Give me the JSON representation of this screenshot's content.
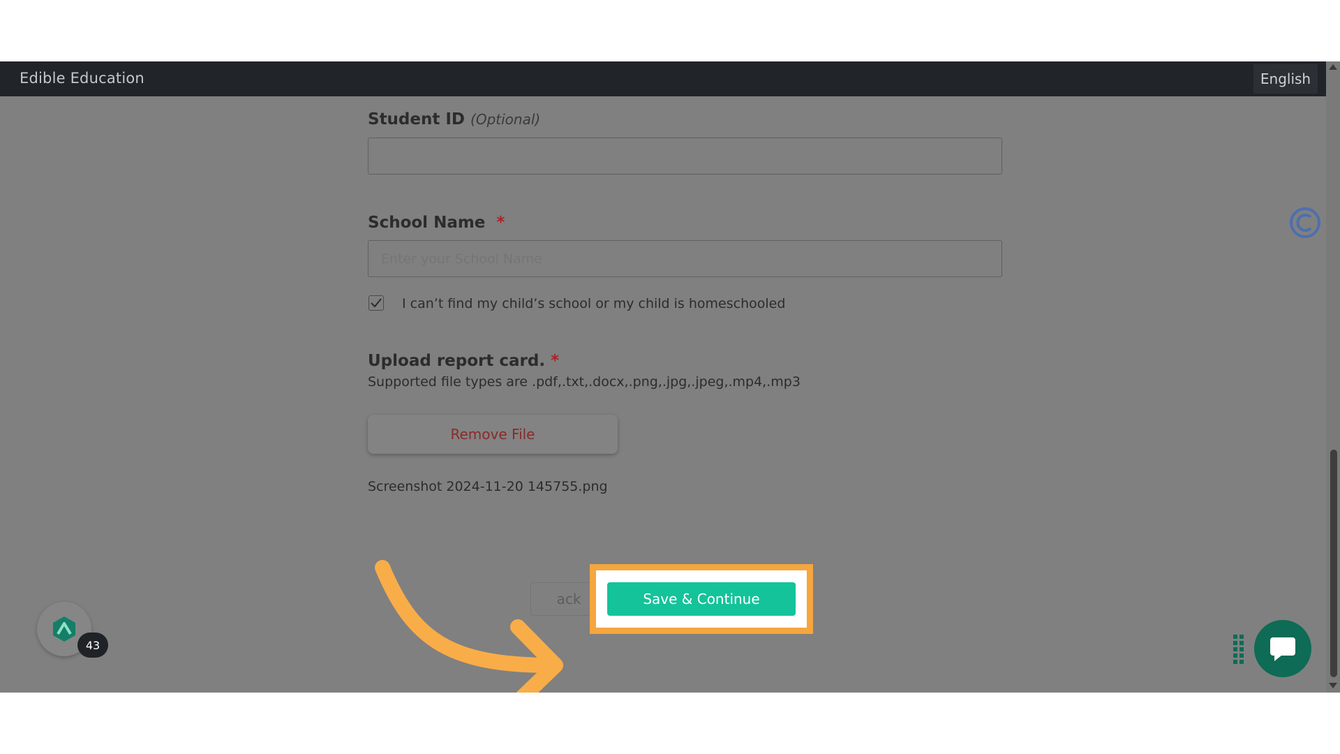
{
  "app": {
    "title": "Edible Education",
    "language": "English"
  },
  "form": {
    "student_id": {
      "label": "Student ID",
      "optional": "(Optional)",
      "value": ""
    },
    "school_name": {
      "label": "School Name",
      "required": "*",
      "placeholder": "Enter your School Name",
      "value": ""
    },
    "homeschool_checkbox": {
      "label": "I can’t find my child’s school or my child is homeschooled",
      "checked": true
    },
    "upload": {
      "label": "Upload report card.",
      "required": "*",
      "filetypes": "Supported file types are .pdf,.txt,.docx,.png,.jpg,.jpeg,.mp4,.mp3",
      "remove_label": "Remove File",
      "filename": "Screenshot 2024-11-20 145755.png"
    },
    "back_label": "ack",
    "save_label": "Save & Continue"
  },
  "widget": {
    "badge_count": "43"
  },
  "colors": {
    "accent": "#14c39a",
    "highlight": "#f5a63e",
    "required": "#a8242b",
    "topbar": "#212529"
  },
  "icons": {
    "annotation_arrow": "curved-arrow-icon",
    "floating_c": "c-logo-icon",
    "widget_logo": "hexagon-logo-icon",
    "chat": "chat-bubble-icon",
    "drag": "drag-dots-icon",
    "checkbox": "checkmark-icon"
  }
}
